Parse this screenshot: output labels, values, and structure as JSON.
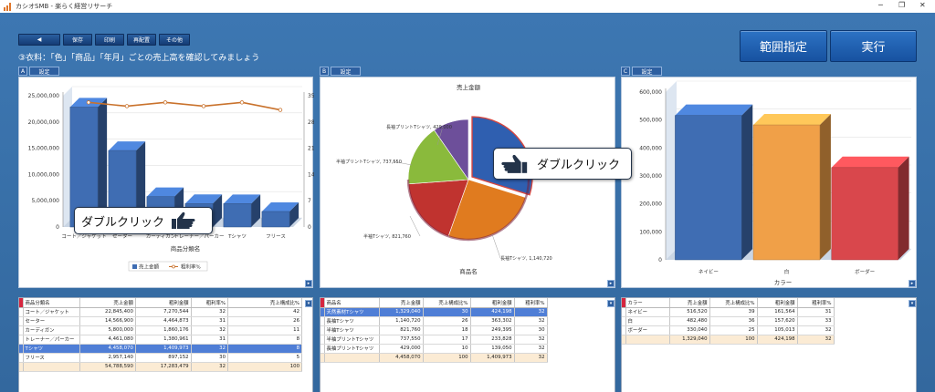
{
  "window": {
    "title": "カシオSMB - 楽らく経営リサーチ",
    "minimize": "─",
    "restore": "❐",
    "close": "✕"
  },
  "toolbar": {
    "back_label": "◀",
    "save_label": "保存",
    "print_label": "印刷",
    "rearrange_label": "再配置",
    "other_label": "その他"
  },
  "actions": {
    "range_label": "範囲指定",
    "run_label": "実行"
  },
  "prompt": "③衣料：「色」「商品」「年月」ごとの売上高を確認してみましょう",
  "panels": [
    {
      "letter": "A",
      "settings_label": "設定"
    },
    {
      "letter": "B",
      "settings_label": "設定"
    },
    {
      "letter": "C",
      "settings_label": "設定"
    }
  ],
  "colors": {
    "bar_blue": "#3f6db3",
    "line_orange": "#c9722c",
    "pie_navy": "#2f5fb0",
    "pie_orange": "#e07b1f",
    "pie_red": "#c0332f",
    "pie_green": "#8aba3c",
    "pie_purple": "#6d4f9a",
    "bar_orange": "#f0a048",
    "bar_red": "#d9474c",
    "selected_row": "#4f7ed6",
    "total_row": "#fbebd4"
  },
  "chart_data": [
    {
      "type": "bar",
      "categories": [
        "コート／ジャケット",
        "セーター",
        "カーディガン",
        "トレーナー／パーカー",
        "Tシャツ",
        "フリース"
      ],
      "series": [
        {
          "name": "売上金額",
          "values": [
            22845400,
            14566900,
            5800000,
            4461080,
            4458070,
            2957140
          ]
        },
        {
          "name": "粗利率%",
          "values": [
            32,
            31,
            32,
            31,
            32,
            30
          ]
        }
      ],
      "xlabel": "商品分類名",
      "y_ticks": [
        "0",
        "5,000,000",
        "10,000,000",
        "15,000,000",
        "20,000,000",
        "25,000,000"
      ],
      "y2_ticks": [
        "0",
        "7",
        "14",
        "21",
        "28",
        "35"
      ],
      "visible_xtick_labels": [
        "コート／ジャケット",
        "セーター",
        "カーディガン",
        "トレーナー／パーカー",
        "Tシャツ",
        "フリース"
      ],
      "ylim": [
        0,
        25000000
      ],
      "y2lim": [
        0,
        35
      ],
      "legend": "bottom",
      "legend_labels": [
        "売上金額",
        "粗利率%"
      ],
      "legend_icons": [
        "legend-bar-icon",
        "legend-line-icon"
      ]
    },
    {
      "type": "pie",
      "title": "売上金額",
      "xlabel": "商品名",
      "slices": [
        {
          "label": "天然素材Tシャツ",
          "value": 1329040,
          "color": "#2f5fb0"
        },
        {
          "label": "長袖Tシャツ",
          "value": 1140720,
          "color": "#e07b1f"
        },
        {
          "label": "半袖Tシャツ",
          "value": 821760,
          "color": "#c0332f"
        },
        {
          "label": "半袖プリントTシャツ",
          "value": 737550,
          "color": "#8aba3c"
        },
        {
          "label": "長袖プリントTシャツ",
          "value": 429000,
          "color": "#6d4f9a"
        }
      ],
      "visible_labels": [
        {
          "text": "長袖プリントTシャツ, 429,000"
        },
        {
          "text": "半袖プリントTシャツ, 737,550"
        },
        {
          "text": "半袖Tシャツ, 821,760"
        },
        {
          "text": "長袖Tシャツ, 1,140,720"
        }
      ]
    },
    {
      "type": "bar",
      "categories": [
        "ネイビー",
        "白",
        "ボーダー"
      ],
      "values": [
        516520,
        482480,
        330040
      ],
      "colors": [
        "#3f6db3",
        "#f0a048",
        "#d9474c"
      ],
      "xlabel": "カラー",
      "y_ticks": [
        "0",
        "100,000",
        "200,000",
        "300,000",
        "400,000",
        "500,000",
        "600,000"
      ],
      "ylim": [
        0,
        600000
      ]
    }
  ],
  "tables": [
    {
      "columns": [
        "商品分類名",
        "売上金額",
        "粗利金額",
        "粗利率%",
        "売上構成比%"
      ],
      "rows": [
        [
          "コート／ジャケット",
          "22,845,400",
          "7,270,544",
          "32",
          "42"
        ],
        [
          "セーター",
          "14,566,900",
          "4,464,873",
          "31",
          "26"
        ],
        [
          "カーディガン",
          "5,800,000",
          "1,860,176",
          "32",
          "11"
        ],
        [
          "トレーナー／パーカー",
          "4,461,080",
          "1,380,961",
          "31",
          "8"
        ],
        [
          "Tシャツ",
          "4,458,070",
          "1,409,973",
          "32",
          "8"
        ],
        [
          "フリース",
          "2,957,140",
          "897,152",
          "30",
          "5"
        ]
      ],
      "total": [
        "",
        "54,788,590",
        "17,283,479",
        "32",
        "100"
      ],
      "selected": 4
    },
    {
      "columns": [
        "商品名",
        "売上金額",
        "売上構成比%",
        "粗利金額",
        "粗利率%"
      ],
      "rows": [
        [
          "天然素材Tシャツ",
          "1,329,040",
          "30",
          "424,198",
          "32"
        ],
        [
          "長袖Tシャツ",
          "1,140,720",
          "26",
          "363,302",
          "32"
        ],
        [
          "半袖Tシャツ",
          "821,760",
          "18",
          "249,395",
          "30"
        ],
        [
          "半袖プリントTシャツ",
          "737,550",
          "17",
          "233,828",
          "32"
        ],
        [
          "長袖プリントTシャツ",
          "429,000",
          "10",
          "139,050",
          "32"
        ]
      ],
      "total": [
        "",
        "4,458,070",
        "100",
        "1,409,973",
        "32"
      ],
      "selected": 0
    },
    {
      "columns": [
        "カラー",
        "売上金額",
        "売上構成比%",
        "粗利金額",
        "粗利率%"
      ],
      "rows": [
        [
          "ネイビー",
          "516,520",
          "39",
          "161,564",
          "31"
        ],
        [
          "白",
          "482,480",
          "36",
          "157,620",
          "33"
        ],
        [
          "ボーダー",
          "330,040",
          "25",
          "105,013",
          "32"
        ]
      ],
      "total": [
        "",
        "1,329,040",
        "100",
        "424,198",
        "32"
      ],
      "selected": -1
    }
  ],
  "callouts": {
    "left": "ダブルクリック",
    "right": "ダブルクリック"
  },
  "icons": {
    "pointing_hand": "pointing-hand-icon",
    "app": "app-icon"
  }
}
